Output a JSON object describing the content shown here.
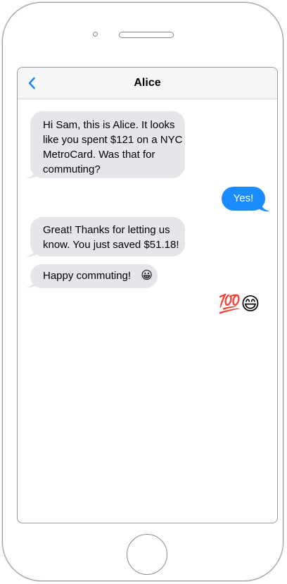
{
  "header": {
    "title": "Alice",
    "back_icon": "chevron-left-icon"
  },
  "colors": {
    "accent": "#1a8cff",
    "incoming_bubble": "#e5e5ea",
    "navbar_bg": "#f6f6f7"
  },
  "messages": [
    {
      "sender": "Alice",
      "direction": "incoming",
      "lines": [
        "Hi Sam, this is Alice. It looks",
        "like you spent $121 on a NYC",
        "MetroCard. Was that for",
        "commuting?"
      ]
    },
    {
      "sender": "Sam",
      "direction": "outgoing",
      "text": "Yes!"
    },
    {
      "sender": "Alice",
      "direction": "incoming",
      "lines": [
        "Great! Thanks for letting us",
        "know. You just saved $51.18!"
      ]
    },
    {
      "sender": "Alice",
      "direction": "incoming",
      "text": "Happy commuting!",
      "emoji": "😀"
    },
    {
      "sender": "Sam",
      "direction": "outgoing",
      "emoji": "💯😄"
    }
  ]
}
